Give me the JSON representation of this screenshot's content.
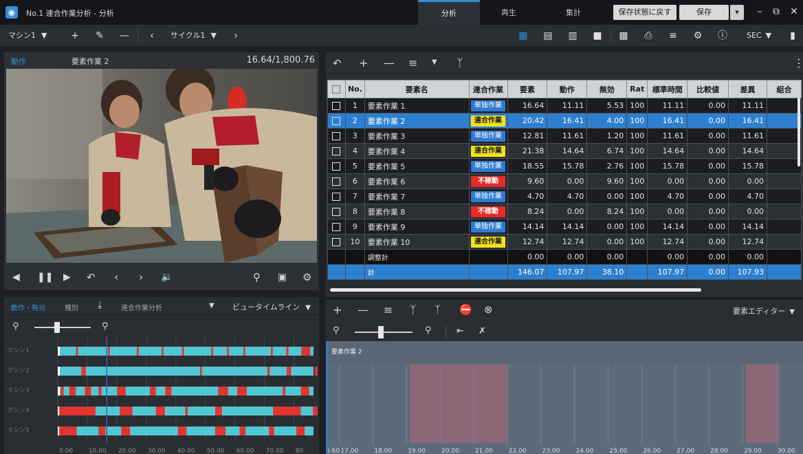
{
  "window": {
    "app_icon": "app-logo-icon",
    "title": "No.1 連合作業分析 - 分析",
    "mode_tabs": [
      "分析",
      "再生",
      "集計"
    ],
    "active_mode_tab": 0,
    "restore_label": "保存状態に戻す",
    "save_label": "保存",
    "controls": [
      "minimize-icon",
      "restore-window-icon",
      "close-icon"
    ]
  },
  "toolbar": {
    "machine_select": "マシン1",
    "cycle_select": "サイクル1",
    "unit_select": "SEC",
    "icons": [
      "add-icon",
      "pencil-icon",
      "minus-icon",
      "chevron-left-icon",
      "chevron-right-icon",
      "layout-grid-icon",
      "layout-split-icon",
      "layout-columns-icon",
      "layout-single-icon",
      "clapper-icon",
      "print-icon",
      "list-icon",
      "gear-icon",
      "info-icon",
      "folder-icon"
    ]
  },
  "video": {
    "tab_label": "動作",
    "element_label": "要素作業 2",
    "time_readout": "16.64/1,800.76",
    "controls": [
      "step-back-icon",
      "pause-icon",
      "play-icon",
      "undo-icon",
      "chevron-left-icon",
      "chevron-right-icon",
      "volume-icon",
      "zoom-icon",
      "image-icon",
      "gear-icon"
    ]
  },
  "table": {
    "toolbar_icons": [
      "undo-icon",
      "add-icon",
      "minus-icon",
      "list-icon",
      "dropdown-icon",
      "person-icon",
      "more-vertical-icon"
    ],
    "columns": [
      "",
      "No.",
      "要素名",
      "連合作業",
      "要素",
      "動作",
      "無効",
      "Rat",
      "標準時間",
      "比較値",
      "差異",
      "組合"
    ],
    "rows": [
      {
        "no": "1",
        "name": "要素作業 1",
        "type": "単独作業",
        "kind": "solo",
        "element": "16.64",
        "motion": "11.11",
        "invalid": "5.53",
        "rat": "100",
        "standard": "11.11",
        "compare": "0.00",
        "diff": "11.11"
      },
      {
        "no": "2",
        "name": "要素作業 2",
        "type": "連合作業",
        "kind": "joint",
        "element": "20.42",
        "motion": "16.41",
        "invalid": "4.00",
        "rat": "100",
        "standard": "16.41",
        "compare": "0.00",
        "diff": "16.41"
      },
      {
        "no": "3",
        "name": "要素作業 3",
        "type": "単独作業",
        "kind": "solo",
        "element": "12.81",
        "motion": "11.61",
        "invalid": "1.20",
        "rat": "100",
        "standard": "11.61",
        "compare": "0.00",
        "diff": "11.61"
      },
      {
        "no": "4",
        "name": "要素作業 4",
        "type": "連合作業",
        "kind": "joint",
        "element": "21.38",
        "motion": "14.64",
        "invalid": "6.74",
        "rat": "100",
        "standard": "14.64",
        "compare": "0.00",
        "diff": "14.64"
      },
      {
        "no": "5",
        "name": "要素作業 5",
        "type": "単独作業",
        "kind": "solo",
        "element": "18.55",
        "motion": "15.78",
        "invalid": "2.76",
        "rat": "100",
        "standard": "15.78",
        "compare": "0.00",
        "diff": "15.78"
      },
      {
        "no": "6",
        "name": "要素作業 6",
        "type": "不稼動",
        "kind": "idle",
        "element": "9.60",
        "motion": "0.00",
        "invalid": "9.60",
        "rat": "100",
        "standard": "0.00",
        "compare": "0.00",
        "diff": "0.00"
      },
      {
        "no": "7",
        "name": "要素作業 7",
        "type": "単独作業",
        "kind": "solo",
        "element": "4.70",
        "motion": "4.70",
        "invalid": "0.00",
        "rat": "100",
        "standard": "4.70",
        "compare": "0.00",
        "diff": "4.70"
      },
      {
        "no": "8",
        "name": "要素作業 8",
        "type": "不稼動",
        "kind": "idle",
        "element": "8.24",
        "motion": "0.00",
        "invalid": "8.24",
        "rat": "100",
        "standard": "0.00",
        "compare": "0.00",
        "diff": "0.00"
      },
      {
        "no": "9",
        "name": "要素作業 9",
        "type": "単独作業",
        "kind": "solo",
        "element": "14.14",
        "motion": "14.14",
        "invalid": "0.00",
        "rat": "100",
        "standard": "14.14",
        "compare": "0.00",
        "diff": "14.14"
      },
      {
        "no": "10",
        "name": "要素作業 10",
        "type": "連合作業",
        "kind": "joint",
        "element": "12.74",
        "motion": "12.74",
        "invalid": "0.00",
        "rat": "100",
        "standard": "12.74",
        "compare": "0.00",
        "diff": "12.74"
      }
    ],
    "selected_row": 1,
    "subtotal": {
      "name": "調整計",
      "element": "0.00",
      "motion": "0.00",
      "invalid": "0.00",
      "standard": "0.00",
      "compare": "0.00",
      "diff": "0.00"
    },
    "total": {
      "name": "計",
      "element": "146.07",
      "motion": "107.97",
      "invalid": "38.10",
      "standard": "107.97",
      "compare": "0.00",
      "diff": "107.93"
    }
  },
  "gantt": {
    "header": {
      "tab_active": "動作・無効",
      "tab_other": "種別",
      "combined_label": "連合作業分析",
      "view_select": "ビュータイムライン"
    },
    "header_icons": [
      "download-icon",
      "dropdown-icon"
    ],
    "zoom_icons": [
      "zoom-out-icon",
      "zoom-in-icon"
    ],
    "slider_level": 0.4,
    "row_labels": [
      "マシン1",
      "マシン2",
      "マシン3",
      "マシン4",
      "マシン5"
    ],
    "x_ticks": [
      "0.00",
      "10.00",
      "20.00",
      "30.00",
      "40.00",
      "50.00",
      "60.00",
      "70.00",
      "80"
    ],
    "x_max": 88,
    "playhead": 16.6,
    "colors": {
      "active": "#52c7d4",
      "invalid": "#e0342f",
      "track": "#3a3c42"
    },
    "rows": [
      {
        "label": "マシン1",
        "invalid": [
          [
            6.2,
            6.8
          ],
          [
            17.0,
            17.6
          ],
          [
            26.8,
            27.4
          ],
          [
            35.2,
            35.8
          ],
          [
            42.1,
            42.7
          ],
          [
            52.0,
            52.6
          ],
          [
            57.3,
            57.9
          ],
          [
            62.9,
            63.5
          ],
          [
            72.2,
            72.8
          ],
          [
            77.4,
            78.1
          ],
          [
            82.5,
            85.5
          ]
        ]
      },
      {
        "label": "マシン2",
        "invalid": [
          [
            8.0,
            9.5
          ],
          [
            48.2,
            48.8
          ],
          [
            71.0,
            71.8
          ],
          [
            77.5,
            79.0
          ],
          [
            87.0,
            88.0
          ]
        ]
      },
      {
        "label": "マシン3",
        "invalid": [
          [
            1.0,
            2.0
          ],
          [
            3.9,
            6.1
          ],
          [
            9.2,
            11.3
          ],
          [
            13.8,
            14.8
          ],
          [
            20.1,
            23.0
          ],
          [
            31.2,
            33.2
          ],
          [
            36.4,
            38.5
          ],
          [
            54.3,
            57.7
          ],
          [
            60.8,
            64.0
          ],
          [
            76.2,
            77.1
          ],
          [
            82.3,
            85.1
          ]
        ]
      },
      {
        "label": "マシン4",
        "invalid": [
          [
            0.5,
            12.8
          ],
          [
            21.0,
            25.3
          ],
          [
            33.2,
            36.3
          ],
          [
            43.2,
            44.0
          ],
          [
            53.3,
            55.6
          ],
          [
            72.9,
            82.3
          ],
          [
            86.4,
            88.0
          ]
        ]
      },
      {
        "label": "マシン5",
        "invalid": [
          [
            0.5,
            6.4
          ],
          [
            13.8,
            16.1
          ],
          [
            21.5,
            24.5
          ],
          [
            40.7,
            43.6
          ],
          [
            53.3,
            56.8
          ],
          [
            61.6,
            63.6
          ],
          [
            71.5,
            73.3
          ],
          [
            80.8,
            83.6
          ]
        ]
      }
    ]
  },
  "timeline": {
    "tool_icons": [
      "add-icon",
      "minus-icon",
      "list-icon",
      "person-icon",
      "fork-icon",
      "no-entry-icon",
      "close-circle-icon"
    ],
    "editor_select": "要素エディター",
    "zoom_icons": [
      "zoom-out-icon",
      "zoom-in-icon",
      "align-start-icon",
      "mute-icon"
    ],
    "slider_level": 0.45,
    "element_label": "要素作業 2",
    "x_range": [
      16.6,
      30.8
    ],
    "playhead": 16.6,
    "ticks": [
      "17.00",
      "18.00",
      "19.00",
      "20.00",
      "21.00",
      "22.00",
      "23.00",
      "24.00",
      "25.00",
      "26.00",
      "27.00",
      "28.00",
      "29.00",
      "30.00"
    ],
    "start_label": "6.60",
    "invalid_ranges": [
      [
        19.1,
        22.0
      ],
      [
        29.1,
        30.1
      ]
    ],
    "colors": {
      "track": "#5d6a7a",
      "invalid": "#8c6776",
      "playhead": "#2f7bd2"
    }
  }
}
